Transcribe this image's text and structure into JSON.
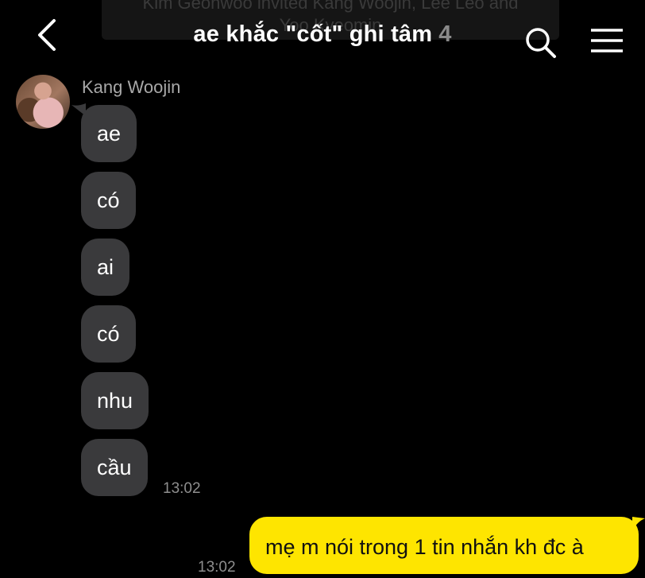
{
  "notice": {
    "line1": "Kim Geonwoo invited Kang Woojin, Lee Leo and",
    "line2": "Yoo Kyeomin"
  },
  "header": {
    "title": "ae khắc \"cốt\" ghi tâm",
    "member_count": "4",
    "icons": [
      "back-icon",
      "search-icon",
      "menu-icon"
    ]
  },
  "conversation": {
    "sender_name": "Kang Woojin",
    "incoming": [
      "ae",
      "có",
      "ai",
      "có",
      "nhu",
      "cầu"
    ],
    "incoming_time": "13:02",
    "outgoing_text": "mẹ m nói trong 1 tin nhắn kh đc à",
    "outgoing_time": "13:02"
  },
  "colors": {
    "background": "#000000",
    "incoming_bubble": "#3a3a3c",
    "outgoing_bubble": "#fee500",
    "timestamp": "#8e8e8e"
  }
}
